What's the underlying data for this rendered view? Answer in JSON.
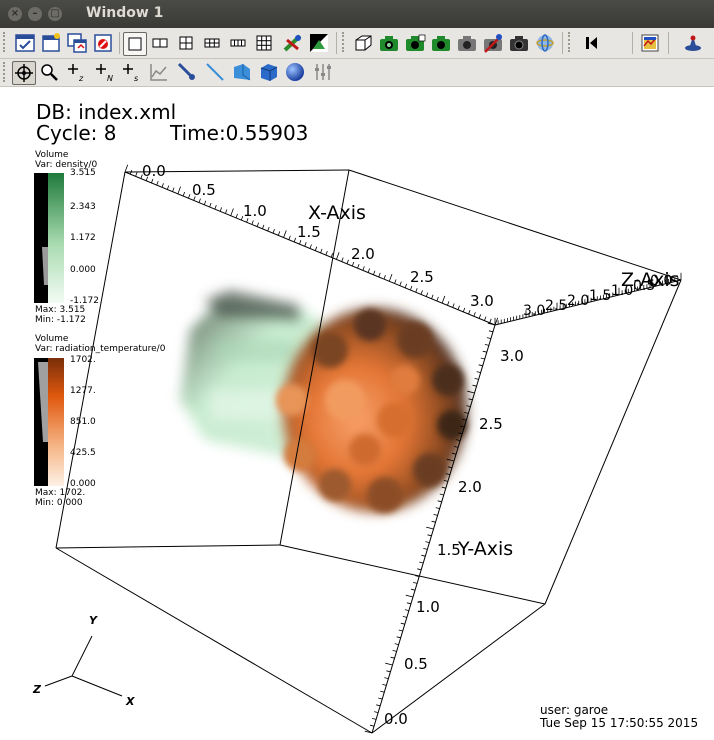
{
  "window": {
    "title": "Window 1"
  },
  "titlebar_buttons": [
    "close-icon",
    "minimize-icon",
    "maximize-icon"
  ],
  "toolbar1": {
    "icons": [
      "active-window-icon",
      "new-window-icon",
      "clone-window-icon",
      "delete-window-icon",
      "layout-1x1-icon",
      "layout-1x2-icon",
      "layout-2x2-icon",
      "layout-2x3-icon",
      "layout-3x2-icon",
      "layout-3x3-icon",
      "lock-view-icon",
      "invert-background-icon",
      "view-3d-box-icon",
      "save-image-icon",
      "save-image-2-icon",
      "camera-icon",
      "camera-gray-icon",
      "camera-delete-icon",
      "camera-dark-icon",
      "spin-icon",
      "play-back-icon",
      "plot-list-icon",
      "operator-icon"
    ],
    "overflow": "»"
  },
  "toolbar2": {
    "icons": [
      "navigate-icon",
      "zoom-icon",
      "zone-pick-icon",
      "node-pick-icon",
      "spreadsheet-pick-icon",
      "lineout-icon",
      "pick-icon",
      "line-tool-icon",
      "plane-tool-icon",
      "box-tool-icon",
      "sphere-tool-icon",
      "sliders-icon"
    ]
  },
  "annotation": {
    "db": "DB: index.xml",
    "cycle": "Cycle: 8",
    "time": "Time:0.55903"
  },
  "legend_density": {
    "plot": "Volume",
    "var": "Var: density/0",
    "ticks": [
      "3.515",
      "2.343",
      "1.172",
      "0.000",
      "-1.172"
    ],
    "max": "Max:  3.515",
    "min": "Min: -1.172",
    "color": "#1f7a3c"
  },
  "legend_temperature": {
    "plot": "Volume",
    "var": "Var: radiation_temperature/0",
    "ticks": [
      "1702.",
      "1277.",
      "851.0",
      "425.5",
      "0.000"
    ],
    "max": "Max:  1702.",
    "min": "Min:  0.000",
    "color": "#e0580f"
  },
  "axes": {
    "x_label": "X-Axis",
    "y_label": "Y-Axis",
    "z_label": "Z-Axis",
    "x_ticks": [
      "0.0",
      "0.5",
      "1.0",
      "1.5",
      "2.0",
      "2.5",
      "3.0"
    ],
    "y_ticks": [
      "3.0",
      "2.5",
      "2.0",
      "1.5",
      "1.0",
      "0.5",
      "0.0"
    ],
    "z_ticks": [
      "3.0",
      "2.5",
      "2.0",
      "1.5",
      "1.0",
      "0.5",
      "0.0"
    ]
  },
  "triad": {
    "x": "X",
    "y": "Y",
    "z": "Z"
  },
  "user": {
    "name": "user: garoe",
    "date": "Tue Sep 15 17:50:55 2015"
  }
}
